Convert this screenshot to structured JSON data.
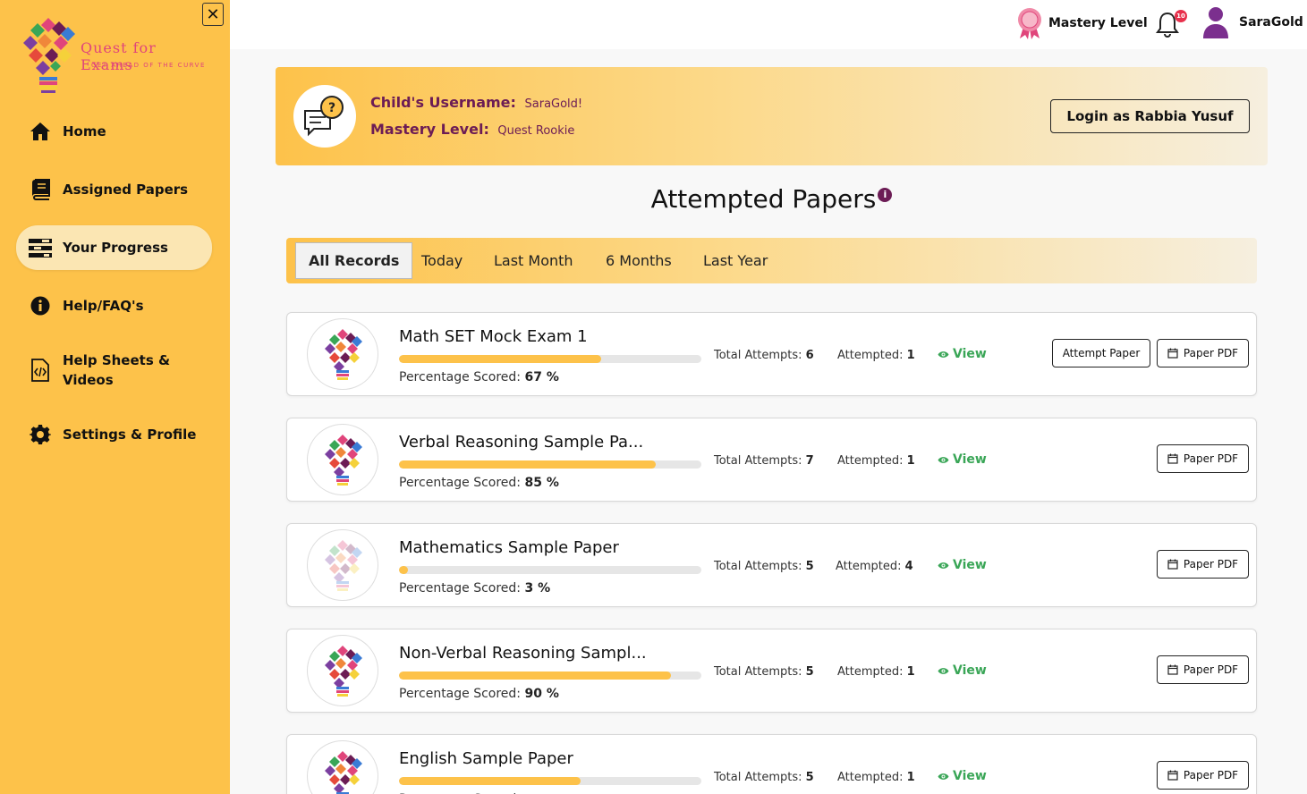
{
  "app": {
    "brand": "Quest for Exams",
    "tagline": "GET AHEAD OF THE CURVE"
  },
  "sidebar": {
    "items": [
      {
        "label": "Home",
        "icon": "home-icon"
      },
      {
        "label": "Assigned Papers",
        "icon": "book-icon"
      },
      {
        "label": "Your Progress",
        "icon": "progress-icon",
        "active": true
      },
      {
        "label": "Help/FAQ's",
        "icon": "info-icon"
      },
      {
        "label": "Help Sheets &",
        "label2": "Videos",
        "icon": "code-file-icon"
      },
      {
        "label": "Settings & Profile",
        "icon": "gear-icon"
      }
    ]
  },
  "topbar": {
    "mastery_label": "Mastery Level",
    "notification_count": "10",
    "username": "SaraGold"
  },
  "banner": {
    "username_label": "Child's Username:",
    "username_value": "SaraGold!",
    "mastery_label": "Mastery Level:",
    "mastery_value": "Quest Rookie",
    "login_button": "Login as Rabbia Yusuf"
  },
  "main": {
    "title": "Attempted Papers",
    "tabs": [
      "All Records",
      "Today",
      "Last Month",
      "6 Months",
      "Last Year"
    ],
    "active_tab": "All Records",
    "labels": {
      "total_attempts": "Total Attempts:",
      "attempted": "Attempted:",
      "percentage": "Percentage Scored:",
      "view": "View",
      "attempt_paper": "Attempt Paper",
      "paper_pdf": "Paper PDF"
    },
    "records": [
      {
        "title": "Math SET Mock Exam 1",
        "percent": 67,
        "percent_text": "67 %",
        "total_attempts": "6",
        "attempted": "1",
        "can_attempt": true
      },
      {
        "title": "Verbal Reasoning Sample Pa...",
        "percent": 85,
        "percent_text": "85 %",
        "total_attempts": "7",
        "attempted": "1",
        "can_attempt": false
      },
      {
        "title": "Mathematics Sample Paper",
        "percent": 3,
        "percent_text": "3 %",
        "total_attempts": "5",
        "attempted": "4",
        "can_attempt": false
      },
      {
        "title": "Non-Verbal Reasoning Sampl...",
        "percent": 90,
        "percent_text": "90 %",
        "total_attempts": "5",
        "attempted": "1",
        "can_attempt": false
      },
      {
        "title": "English Sample Paper",
        "percent": 60,
        "percent_text": "",
        "total_attempts": "5",
        "attempted": "1",
        "can_attempt": false
      }
    ]
  },
  "colors": {
    "sidebar": "#fdc24a",
    "brand_purple": "#6c1c55",
    "view_green": "#3aa657",
    "badge_red": "#e8304c"
  }
}
